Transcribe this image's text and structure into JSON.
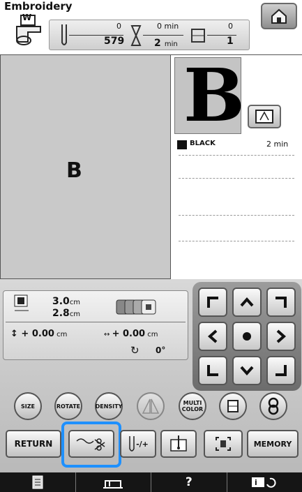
{
  "header": {
    "title": "Embroidery",
    "presser_foot_label": "W",
    "stitch_done": "0",
    "stitch_total": "579",
    "time_done_value": "0",
    "time_done_unit": "min",
    "time_total_value": "2",
    "time_total_unit": "min",
    "color_done": "0",
    "color_total": "1"
  },
  "preview": {
    "design_letter": "B",
    "thumbnail_letter": "B"
  },
  "thread_list": [
    {
      "color_name": "BLACK",
      "time": "2 min",
      "swatch": "#111111"
    }
  ],
  "info": {
    "width": "3.0",
    "height": "2.8",
    "size_unit": "cm",
    "offset_y": "+ 0.00",
    "offset_x": "+ 0.00",
    "offset_unit": "cm",
    "rotation": "0°"
  },
  "buttons": {
    "size": "SIZE",
    "rotate": "ROTATE",
    "density": "DENSITY",
    "multi_color": "MULTI COLOR",
    "return": "RETURN",
    "memory": "MEMORY",
    "needle_adjust": "-/+",
    "help": "?"
  },
  "colors": {
    "highlight": "#1e90ff",
    "accent_text": "#ffffff"
  }
}
